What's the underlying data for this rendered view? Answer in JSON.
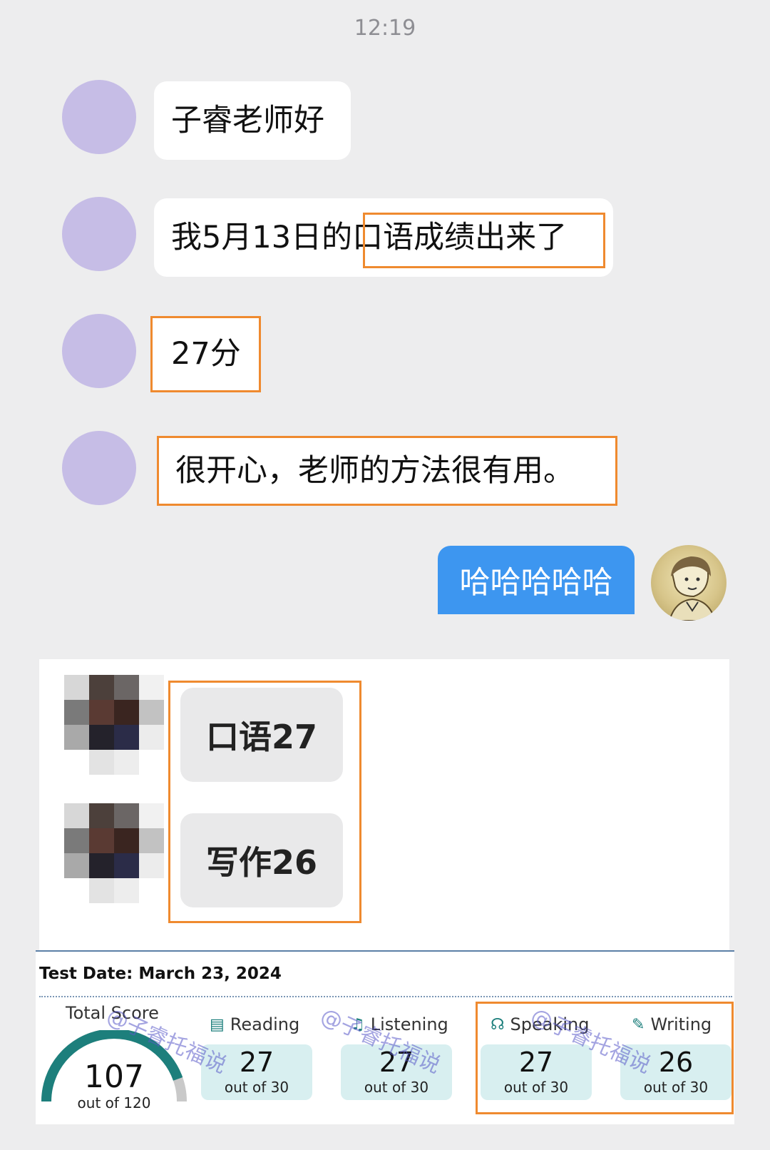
{
  "chat": {
    "time": "12:19",
    "incoming": [
      {
        "text": "子睿老师好"
      },
      {
        "text_before": "我5月13日的",
        "text_highlight": "口语成绩出来了"
      },
      {
        "text": "27分"
      },
      {
        "text": "很开心，老师的方法很有用。"
      }
    ],
    "outgoing": {
      "text": "哈哈哈哈哈"
    }
  },
  "group_card": {
    "messages": [
      "口语27",
      "写作26"
    ]
  },
  "score_report": {
    "test_date": "Test Date: March 23, 2024",
    "total": {
      "label": "Total Score",
      "score": "107",
      "out_of": "out of 120",
      "fraction": 0.892
    },
    "sections": [
      {
        "label": "Reading",
        "icon": "book-icon",
        "score": "27",
        "out_of": "out of 30"
      },
      {
        "label": "Listening",
        "icon": "headphones-icon",
        "score": "27",
        "out_of": "out of 30"
      },
      {
        "label": "Speaking",
        "icon": "speaker-person-icon",
        "score": "27",
        "out_of": "out of 30"
      },
      {
        "label": "Writing",
        "icon": "pen-icon",
        "score": "26",
        "out_of": "out of 30"
      }
    ],
    "watermark": "@子睿托福说"
  },
  "colors": {
    "highlight": "#ef8a2f",
    "outgoing_bubble": "#3d96f0",
    "gauge": "#1d7f7c",
    "avatar": "#c6bde6"
  }
}
